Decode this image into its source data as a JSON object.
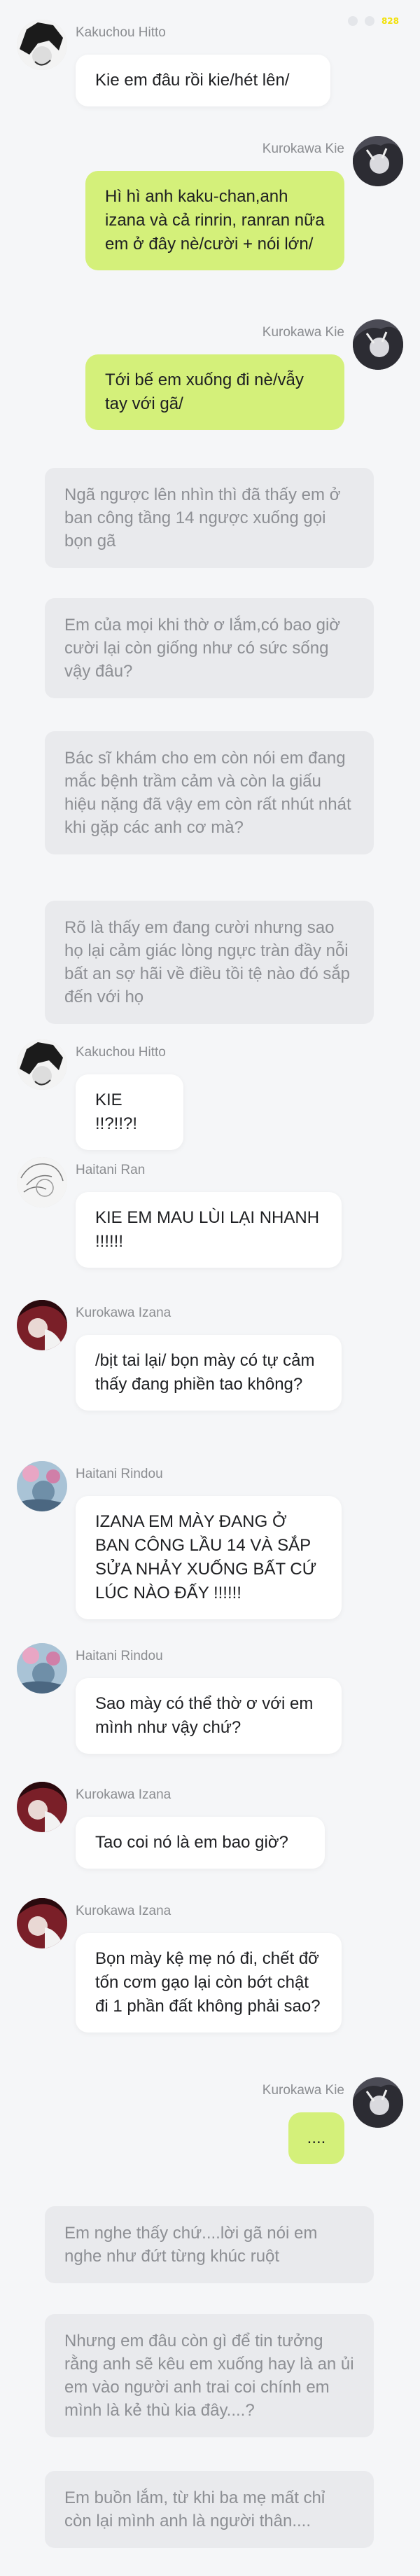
{
  "status": {
    "badge": "828"
  },
  "messages": [
    {
      "type": "chat",
      "side": "left",
      "sender": "Kakuchou Hitto",
      "avatar_icon": "avatar-kakuchou-icon",
      "avatar_color": "#2a2a2a",
      "text": "Kie em đâu rồi kie/hét lên/"
    },
    {
      "type": "chat",
      "side": "right",
      "sender": "Kurokawa Kie",
      "avatar_icon": "avatar-kie-icon",
      "avatar_color": "#3b3b45",
      "text": "Hì hì anh kaku-chan,anh izana và cả rinrin, ranran nữa em ở đây nè/cười + nói lớn/"
    },
    {
      "type": "chat",
      "side": "right",
      "sender": "Kurokawa Kie",
      "avatar_icon": "avatar-kie-icon",
      "avatar_color": "#3b3b45",
      "text": "Tới bế em xuống đi nè/vẫy tay với gã/"
    },
    {
      "type": "narration",
      "text": "Ngã ngược lên nhìn thì đã thấy em ở ban công tầng 14 ngược xuống gọi bọn gã"
    },
    {
      "type": "narration",
      "text": "Em của mọi khi thờ ơ lắm,có bao giờ cười lại còn giống như có sức sống vậy đâu?"
    },
    {
      "type": "narration",
      "text": "Bác sĩ khám cho em còn nói em đang mắc bệnh trầm cảm và còn la giấu hiệu nặng đã vậy em còn rất nhút nhát khi gặp các anh cơ mà?"
    },
    {
      "type": "narration",
      "text": "Rõ là thấy em đang cười nhưng sao họ lại cảm giác lòng ngực tràn đầy nỗi bất an sợ hãi về điều tồi tệ nào đó sắp đến với họ"
    },
    {
      "type": "chat",
      "side": "left",
      "sender": "Kakuchou Hitto",
      "avatar_icon": "avatar-kakuchou-icon",
      "avatar_color": "#2a2a2a",
      "text": "KIE !!?!!?!"
    },
    {
      "type": "chat",
      "side": "left",
      "sender": "Haitani Ran",
      "avatar_icon": "avatar-ran-icon",
      "avatar_color": "#e8e8e8",
      "text": "KIE EM MAU LÙI LẠI NHANH !!!!!!"
    },
    {
      "type": "chat",
      "side": "left",
      "sender": "Kurokawa Izana",
      "avatar_icon": "avatar-izana-icon",
      "avatar_color": "#6a1a22",
      "text": "/bịt tai lại/ bọn mày có tự cảm thấy đang phiền tao không?"
    },
    {
      "type": "chat",
      "side": "left",
      "sender": "Haitani Rindou",
      "avatar_icon": "avatar-rindou-icon",
      "avatar_color": "#8fb0c8",
      "text": "IZANA EM MÀY ĐANG Ở BAN CÔNG LẦU 14 VÀ SẮP SỬA NHẢY XUỐNG BẤT CỨ LÚC NÀO ĐẤY !!!!!!"
    },
    {
      "type": "chat",
      "side": "left",
      "sender": "Haitani Rindou",
      "avatar_icon": "avatar-rindou-icon",
      "avatar_color": "#8fb0c8",
      "text": "Sao mày có thể thờ ơ với em mình như vậy chứ?"
    },
    {
      "type": "chat",
      "side": "left",
      "sender": "Kurokawa Izana",
      "avatar_icon": "avatar-izana-icon",
      "avatar_color": "#6a1a22",
      "text": "Tao coi nó là em bao giờ?"
    },
    {
      "type": "chat",
      "side": "left",
      "sender": "Kurokawa Izana",
      "avatar_icon": "avatar-izana-icon",
      "avatar_color": "#6a1a22",
      "text": "Bọn mày kệ mẹ nó đi, chết đỡ tốn cơm gạo lại còn bớt chật đi 1 phần đất không phải sao?"
    },
    {
      "type": "chat",
      "side": "right",
      "sender": "Kurokawa Kie",
      "avatar_icon": "avatar-kie-icon",
      "avatar_color": "#3b3b45",
      "text": "...."
    },
    {
      "type": "narration",
      "text": "Em nghe thấy chứ....lời gã nói em nghe như đứt từng khúc ruột"
    },
    {
      "type": "narration",
      "text": "Nhưng em đâu còn gì để tin tưởng rằng anh sẽ kêu em xuống hay là an ủi em vào người anh trai coi chính em mình là kẻ thù kia đây....?"
    },
    {
      "type": "narration",
      "text": "Em buồn lắm, từ khi ba mẹ mất chỉ còn lại mình anh là người thân...."
    }
  ]
}
